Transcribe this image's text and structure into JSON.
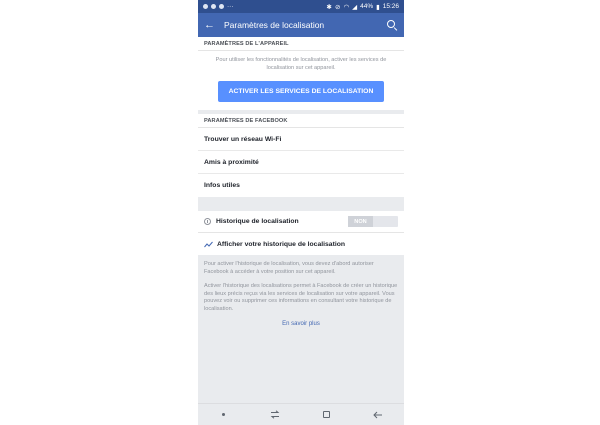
{
  "status_bar": {
    "battery": "44%",
    "time": "15:26"
  },
  "app_bar": {
    "title": "Paramètres de localisation"
  },
  "device_section": {
    "header": "PARAMÈTRES DE L'APPAREIL",
    "description": "Pour utiliser les fonctionnalités de localisation, activer les services de localisation sur cet appareil.",
    "button_label": "ACTIVER LES SERVICES DE LOCALISATION"
  },
  "facebook_section": {
    "header": "PARAMÈTRES DE FACEBOOK",
    "items": [
      {
        "label": "Trouver un réseau Wi-Fi"
      },
      {
        "label": "Amis à proximité"
      },
      {
        "label": "Infos utiles"
      }
    ]
  },
  "history": {
    "toggle_label": "Historique de localisation",
    "toggle_value": "NON",
    "view_link": "Afficher votre historique de localisation"
  },
  "info": {
    "paragraph1": "Pour activer l'historique de localisation, vous devez d'abord autoriser Facebook à accéder à votre position sur cet appareil.",
    "paragraph2": "Activer l'historique des localisations permet à Facebook de créer un historique des lieux précis reçus via les services de localisation sur votre appareil. Vous pouvez voir ou supprimer ces informations en consultant votre historique de localisation.",
    "learn_more": "En savoir plus"
  },
  "colors": {
    "status_bar": "#2f4f8f",
    "app_bar": "#4267b2",
    "primary_button": "#5890ff",
    "link": "#4267b2",
    "background_gray": "#e9ebee"
  },
  "icons": {
    "back": "arrow-left-icon",
    "search": "search-icon",
    "history": "clock-icon",
    "trend": "trend-line-icon",
    "nav_dot": "dot-icon",
    "nav_recent": "recent-apps-icon",
    "nav_home": "home-square-icon",
    "nav_back": "back-arrow-icon"
  }
}
